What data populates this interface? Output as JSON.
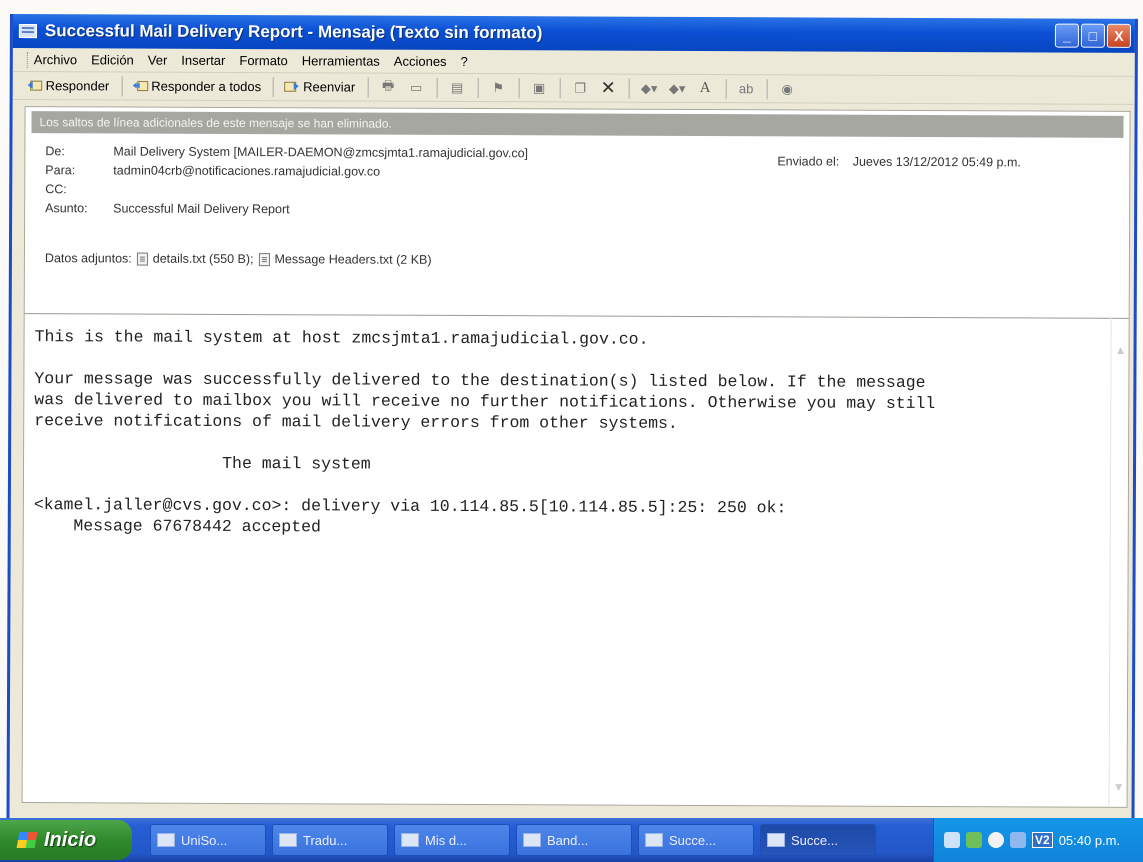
{
  "window": {
    "title": "Successful Mail Delivery Report - Mensaje (Texto sin formato)",
    "controls": [
      "_",
      "□",
      "X"
    ]
  },
  "menu": [
    "Archivo",
    "Edición",
    "Ver",
    "Insertar",
    "Formato",
    "Herramientas",
    "Acciones",
    "?"
  ],
  "toolbar": {
    "reply": "Responder",
    "reply_all": "Responder a todos",
    "forward": "Reenviar",
    "font_size": "A"
  },
  "infobar": "Los saltos de línea adicionales de este mensaje se han eliminado.",
  "headers": {
    "from_label": "De:",
    "from_value": "Mail Delivery System [MAILER-DAEMON@zmcsjmta1.ramajudicial.gov.co]",
    "to_label": "Para:",
    "to_value": "tadmin04crb@notificaciones.ramajudicial.gov.co",
    "cc_label": "CC:",
    "subject_label": "Asunto:",
    "subject_value": "Successful Mail Delivery Report",
    "sent_label": "Enviado el:",
    "sent_value": "Jueves 13/12/2012 05:49 p.m.",
    "attach_label": "Datos adjuntos:",
    "attach_1": "details.txt (550 B);",
    "attach_2": "Message Headers.txt (2 KB)"
  },
  "body": "This is the mail system at host zmcsjmta1.ramajudicial.gov.co.\n\nYour message was successfully delivered to the destination(s) listed below. If the message\nwas delivered to mailbox you will receive no further notifications. Otherwise you may still\nreceive notifications of mail delivery errors from other systems.\n\n                   The mail system\n\n<kamel.jaller@cvs.gov.co>: delivery via 10.114.85.5[10.114.85.5]:25: 250 ok:\n    Message 67678442 accepted",
  "taskbar": {
    "start": "Inicio",
    "tasks": [
      "UniSo...",
      "Tradu...",
      "Mis d...",
      "Band...",
      "Succe...",
      "Succe..."
    ],
    "tray_label": "V2",
    "clock": "05:40 p.m."
  },
  "colors": {
    "titlebar": "#0a4fd4",
    "taskbar": "#245ed4",
    "start_button": "#2f8a2b",
    "infobar": "#a7a7a1"
  }
}
